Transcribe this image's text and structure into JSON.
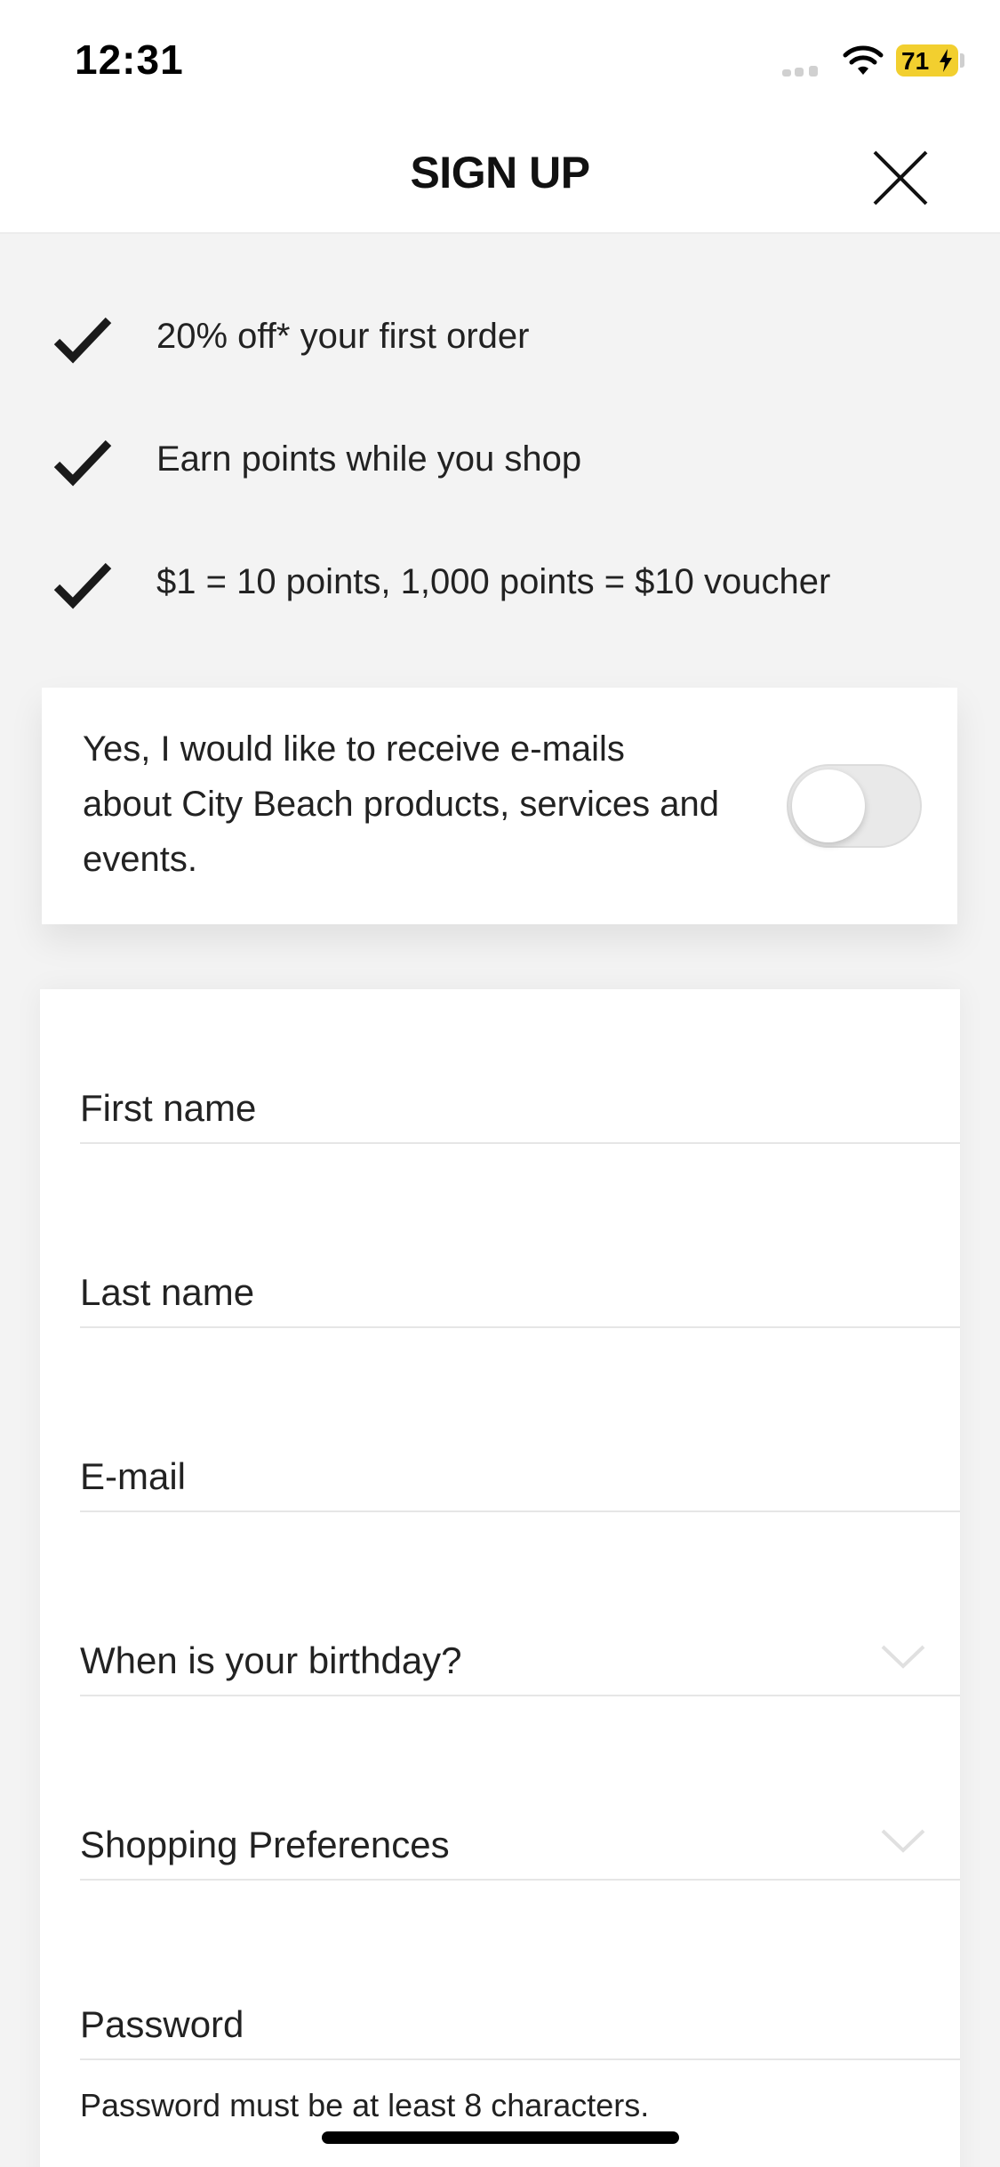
{
  "status_bar": {
    "time": "12:31",
    "battery": "71"
  },
  "header": {
    "title": "SIGN UP",
    "close_icon": "close-icon"
  },
  "benefits": [
    {
      "text": "20% off* your first order",
      "icon": "check-icon"
    },
    {
      "text": "Earn points while you shop",
      "icon": "check-icon"
    },
    {
      "text": "$1 = 10 points, 1,000 points = $10 voucher",
      "icon": "check-icon"
    }
  ],
  "consent": {
    "text": "Yes, I would like to receive e-mails about City Beach products, services and events.",
    "toggle_on": false
  },
  "form": {
    "fields": [
      {
        "label": "First name"
      },
      {
        "label": "Last name"
      },
      {
        "label": "E-mail"
      },
      {
        "label": "When is your birthday?",
        "icon": "chevron-down-icon"
      },
      {
        "label": "Shopping Preferences",
        "icon": "chevron-down-icon"
      },
      {
        "label": "Password"
      }
    ],
    "password_hint": "Password must be at least 8 characters."
  },
  "colors": {
    "battery": "#f2cf2f",
    "background": "#f3f3f3",
    "card": "#ffffff",
    "text": "#1a1a1a"
  }
}
